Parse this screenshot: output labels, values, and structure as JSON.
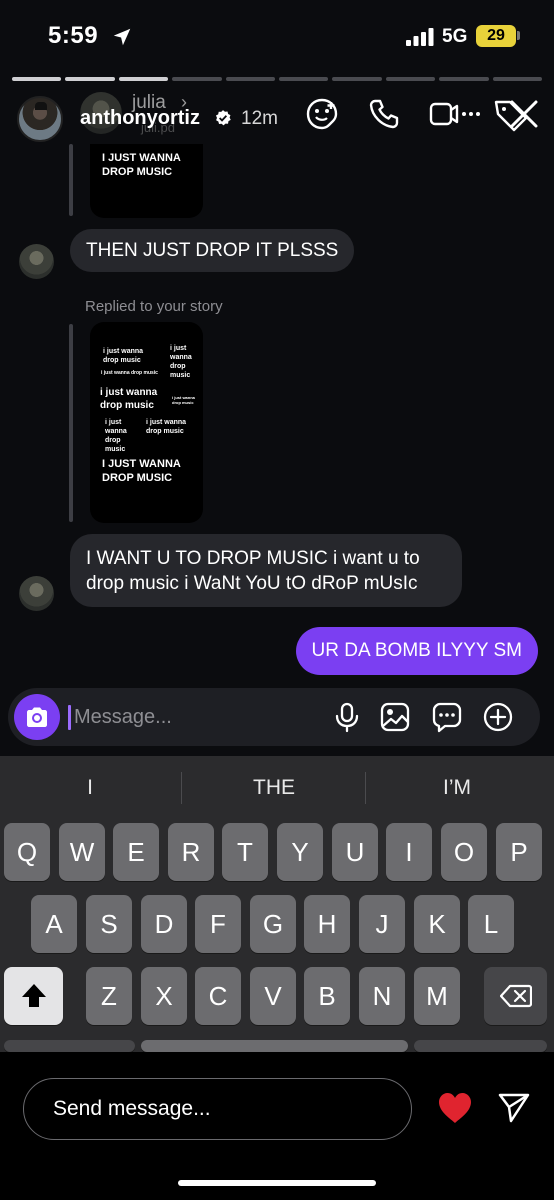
{
  "status_bar": {
    "time": "5:59",
    "network": "5G",
    "battery": "29",
    "icons": [
      "location-arrow-icon",
      "signal-bars-icon"
    ]
  },
  "story": {
    "progress": {
      "total_segments": 10,
      "completed": 3
    },
    "username": "anthonyortiz",
    "verified": true,
    "time_ago": "12m",
    "overlay_name": "julia",
    "overlay_chevron": "›",
    "overlay_handle": "juli.pd",
    "header_icons": [
      "sticker-face-icon",
      "phone-icon",
      "video-camera-icon",
      "tag-icon",
      "close-icon"
    ]
  },
  "chat": {
    "first_card_caption": "I JUST WANNA DROP MUSIC",
    "messages": [
      {
        "from": "them",
        "text": "THEN JUST DROP IT PLSSS"
      },
      {
        "from": "them",
        "text": "I WANT U TO DROP MUSIC i want u to drop music i WaNt YoU tO dRoP mUsIc"
      },
      {
        "from": "me",
        "text": "UR DA BOMB ILYYY SM"
      }
    ],
    "replied_label": "Replied to your story",
    "story_card": {
      "t1": "i just wanna drop music",
      "t2": "i just wanna drop music",
      "t3": "i just wanna drop music",
      "t4": "i just wanna drop music",
      "t5": "i just wanna drop music",
      "t6": "i just wanna drop music",
      "t7": "i just wanna drop music",
      "big": "I JUST WANNA DROP MUSIC"
    }
  },
  "composer": {
    "placeholder": "Message...",
    "icons": [
      "camera-icon",
      "microphone-icon",
      "image-icon",
      "chat-bubble-icon",
      "plus-circle-icon"
    ]
  },
  "keyboard": {
    "suggestions": [
      "I",
      "THE",
      "I’M"
    ],
    "row1": [
      "Q",
      "W",
      "E",
      "R",
      "T",
      "Y",
      "U",
      "I",
      "O",
      "P"
    ],
    "row2": [
      "A",
      "S",
      "D",
      "F",
      "G",
      "H",
      "J",
      "K",
      "L"
    ],
    "row3": [
      "Z",
      "X",
      "C",
      "V",
      "B",
      "N",
      "M"
    ]
  },
  "reply_bar": {
    "placeholder": "Send message...",
    "icons": [
      "heart-icon",
      "send-paper-plane-icon"
    ]
  },
  "colors": {
    "accent": "#7b3ff2",
    "background": "#0b0c0f",
    "incoming_bubble": "#26272c",
    "heart": "#e0242f",
    "battery": "#e8d23a"
  }
}
